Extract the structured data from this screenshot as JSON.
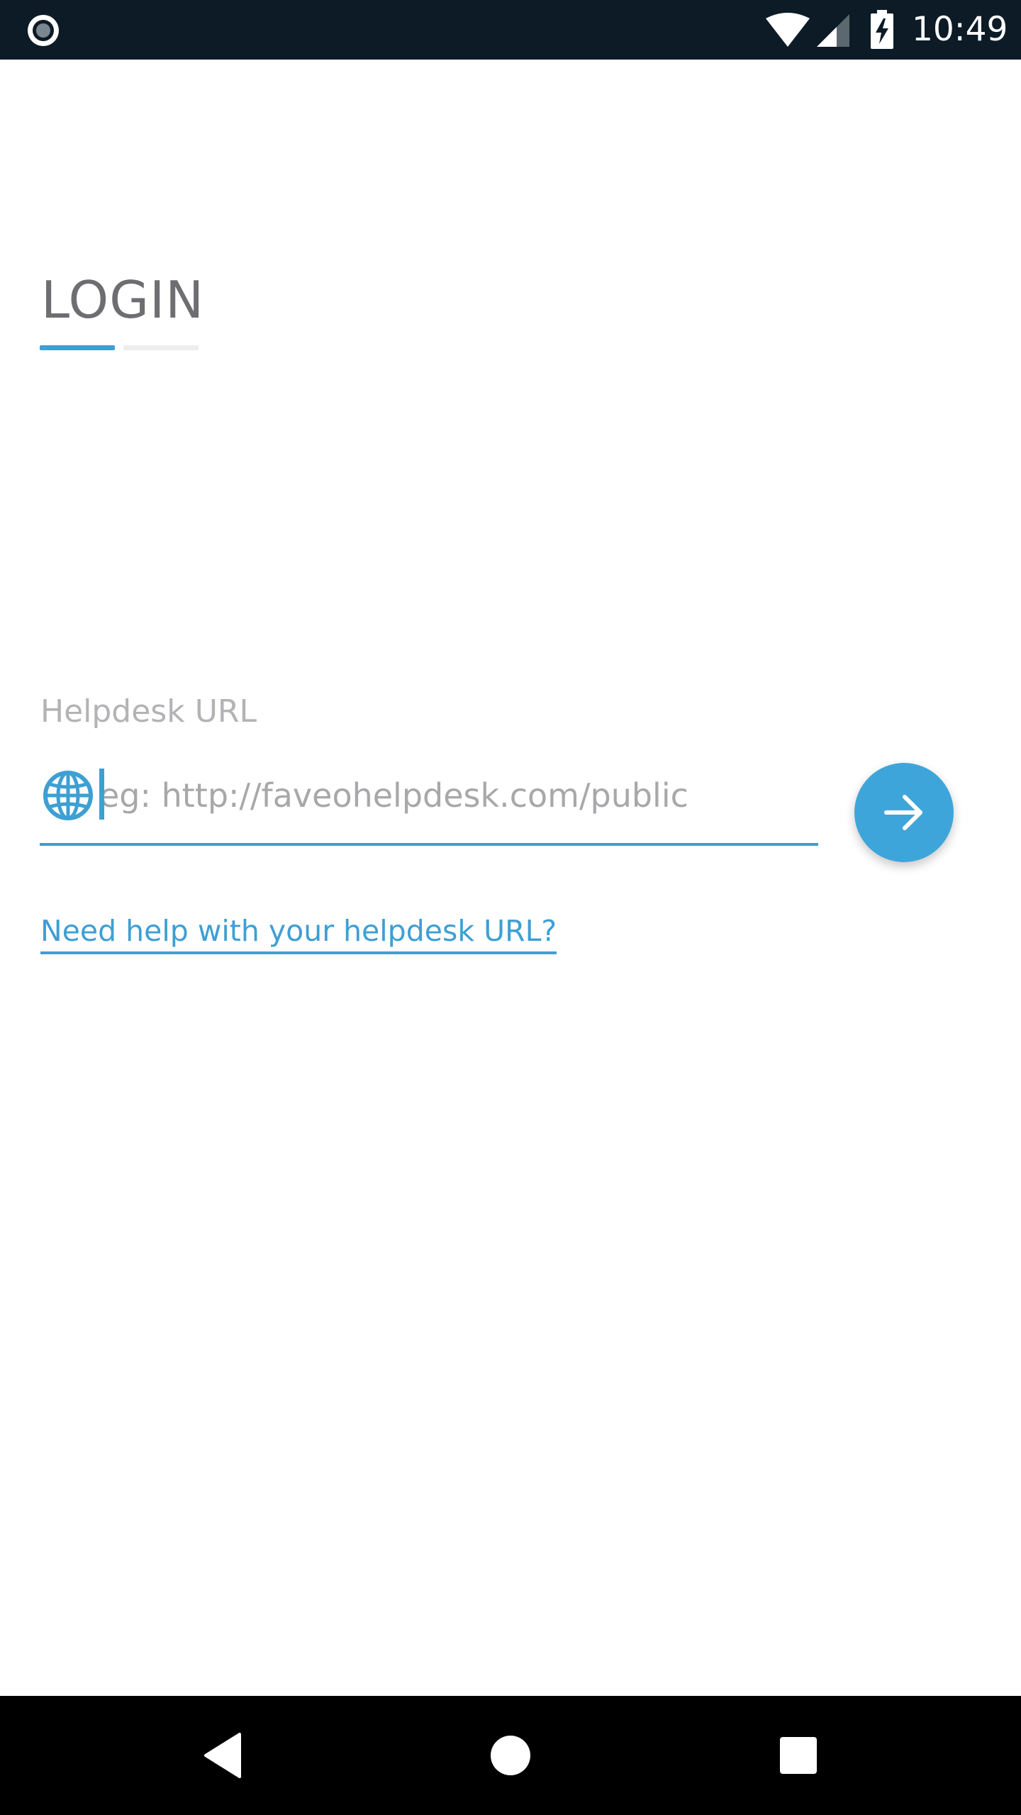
{
  "status_bar": {
    "time": "10:49",
    "icons": [
      "record-icon",
      "wifi-icon",
      "signal-icon",
      "battery-charging-icon"
    ]
  },
  "login": {
    "title": "LOGIN",
    "page_indicator": {
      "total": 2,
      "active": 1
    }
  },
  "url_field": {
    "label": "Helpdesk URL",
    "placeholder": "eg: http://faveohelpdesk.com/public",
    "value": "",
    "icon": "globe-icon"
  },
  "submit": {
    "icon": "arrow-right-icon"
  },
  "help_link": {
    "label": "Need help with your helpdesk URL?"
  },
  "navigation": {
    "icons": [
      "back-icon",
      "home-icon",
      "recents-icon"
    ]
  },
  "colors": {
    "accent": "#3e9fd3",
    "status_bar_bg": "#0c1b26",
    "title": "#6e6e72",
    "label": "#b3b3b6",
    "nav_bar_bg": "#000000"
  }
}
